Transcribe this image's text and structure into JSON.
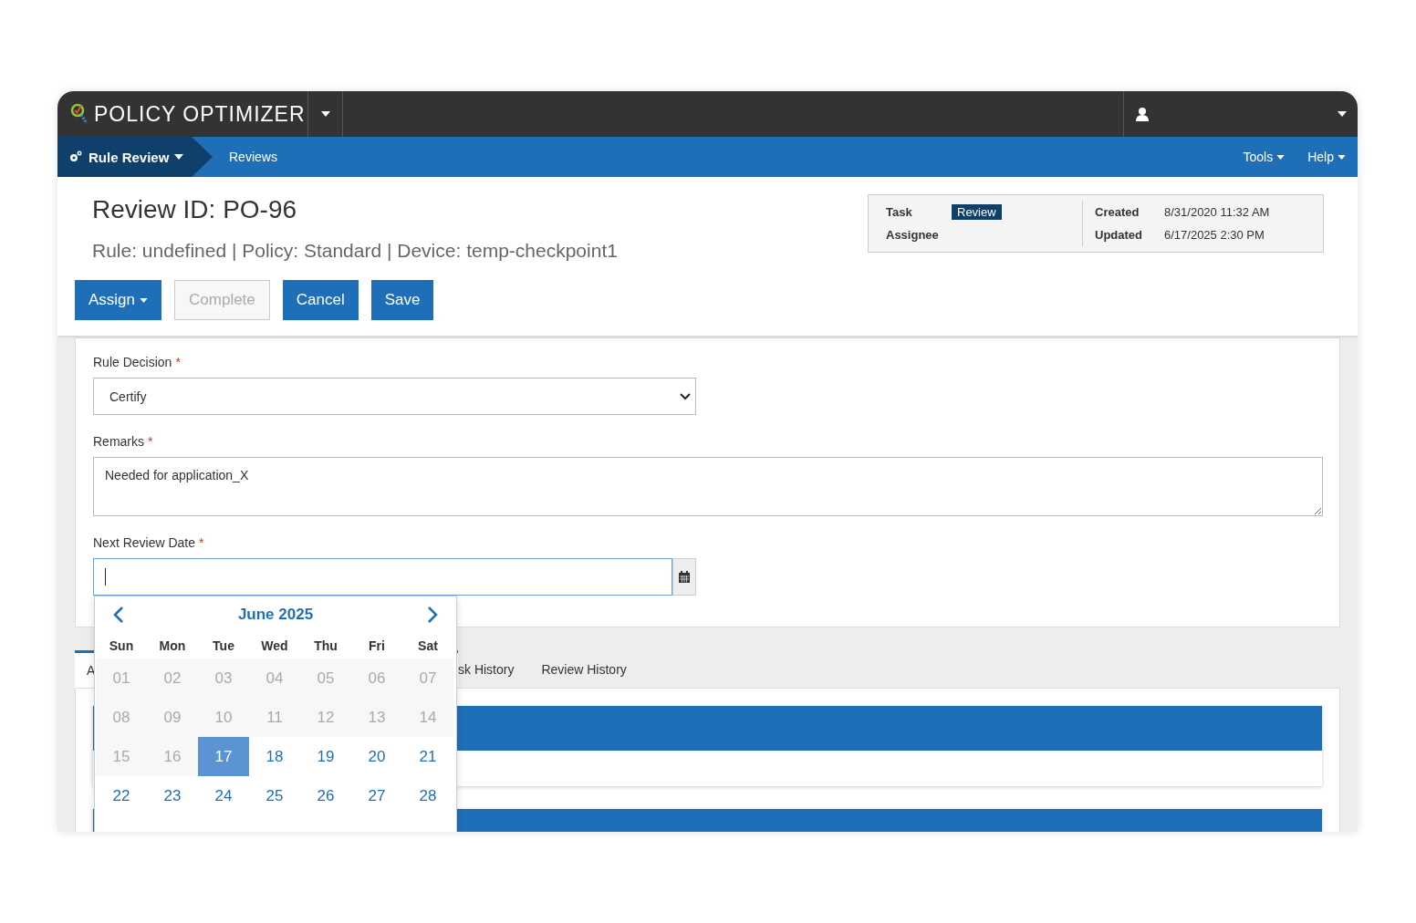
{
  "app": {
    "title": "POLICY OPTIMIZER"
  },
  "nav": {
    "section": "Rule Review",
    "link": "Reviews",
    "menus": [
      "Tools",
      "Help"
    ]
  },
  "review": {
    "title": "Review ID: PO-96",
    "subtitle": "Rule: undefined | Policy: Standard | Device: temp-checkpoint1"
  },
  "actions": [
    {
      "label": "Assign",
      "dropdown": true,
      "disabled": false
    },
    {
      "label": "Complete",
      "dropdown": false,
      "disabled": true
    },
    {
      "label": "Cancel",
      "dropdown": false,
      "disabled": false
    },
    {
      "label": "Save",
      "dropdown": false,
      "disabled": false
    }
  ],
  "info": {
    "left": [
      {
        "label": "Task",
        "value": "Review",
        "kind": "badge"
      },
      {
        "label": "Assignee"
      }
    ],
    "right": [
      {
        "label": "Created",
        "value": "8/31/2020 11:32 AM"
      },
      {
        "label": "Updated",
        "value": "6/17/2025 2:30 PM"
      }
    ]
  },
  "form": {
    "fields": [
      {
        "kind": "select",
        "label": "Rule Decision",
        "mark": "*",
        "value": "Certify"
      },
      {
        "kind": "textarea",
        "label": "Remarks",
        "mark": "*",
        "value": "Needed for application_X"
      },
      {
        "kind": "date",
        "label": "Next Review Date",
        "mark": "*"
      }
    ]
  },
  "calendar": {
    "month": "June 2025",
    "weekdays": [
      "Sun",
      "Mon",
      "Tue",
      "Wed",
      "Thu",
      "Fri",
      "Sat"
    ],
    "weeks": [
      [
        {
          "day": "01",
          "disabled": true,
          "selected": false
        },
        {
          "day": "02",
          "disabled": true,
          "selected": false
        },
        {
          "day": "03",
          "disabled": true,
          "selected": false
        },
        {
          "day": "04",
          "disabled": true,
          "selected": false
        },
        {
          "day": "05",
          "disabled": true,
          "selected": false
        },
        {
          "day": "06",
          "disabled": true,
          "selected": false
        },
        {
          "day": "07",
          "disabled": true,
          "selected": false
        }
      ],
      [
        {
          "day": "08",
          "disabled": true,
          "selected": false
        },
        {
          "day": "09",
          "disabled": true,
          "selected": false
        },
        {
          "day": "10",
          "disabled": true,
          "selected": false
        },
        {
          "day": "11",
          "disabled": true,
          "selected": false
        },
        {
          "day": "12",
          "disabled": true,
          "selected": false
        },
        {
          "day": "13",
          "disabled": true,
          "selected": false
        },
        {
          "day": "14",
          "disabled": true,
          "selected": false
        }
      ],
      [
        {
          "day": "15",
          "disabled": true,
          "selected": false
        },
        {
          "day": "16",
          "disabled": true,
          "selected": false
        },
        {
          "day": "17",
          "disabled": false,
          "selected": true
        },
        {
          "day": "18",
          "disabled": false,
          "selected": false
        },
        {
          "day": "19",
          "disabled": false,
          "selected": false
        },
        {
          "day": "20",
          "disabled": false,
          "selected": false
        },
        {
          "day": "21",
          "disabled": false,
          "selected": false
        }
      ],
      [
        {
          "day": "22",
          "disabled": false,
          "selected": false
        },
        {
          "day": "23",
          "disabled": false,
          "selected": false
        },
        {
          "day": "24",
          "disabled": false,
          "selected": false
        },
        {
          "day": "25",
          "disabled": false,
          "selected": false
        },
        {
          "day": "26",
          "disabled": false,
          "selected": false
        },
        {
          "day": "27",
          "disabled": false,
          "selected": false
        },
        {
          "day": "28",
          "disabled": false,
          "selected": false
        }
      ]
    ]
  },
  "tabs": [
    {
      "label": "A",
      "selected": true
    },
    {
      "label": "sk History",
      "selected": false
    },
    {
      "label": "Review History",
      "selected": false
    }
  ]
}
